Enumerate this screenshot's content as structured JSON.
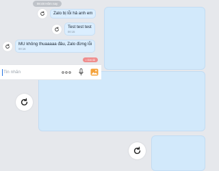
{
  "time_chip": "08:48 Hôm nay",
  "messages": [
    {
      "text": "Zalo bị lỗi hả anh em",
      "time": ""
    },
    {
      "text": "Test test test",
      "time": "00:15"
    },
    {
      "text": "MU không thuaaaaa đâu, Zalo đừng lỗi",
      "time": "00:16"
    }
  ],
  "error_chip": "• Gửi lỗi",
  "composer": {
    "placeholder": "Tin nhắn",
    "value": ""
  },
  "icons": {
    "message_action": "refresh-icon",
    "more": "more-dots-icon",
    "mic": "microphone-icon",
    "image": "image-icon",
    "floating": "refresh-icon"
  },
  "colors": {
    "background": "#e6e8ec",
    "bubble": "#dbeeff",
    "composer_caret": "#1f6fe0",
    "image_icon": "#f4a23a",
    "error_chip": "#ef8d8d"
  }
}
